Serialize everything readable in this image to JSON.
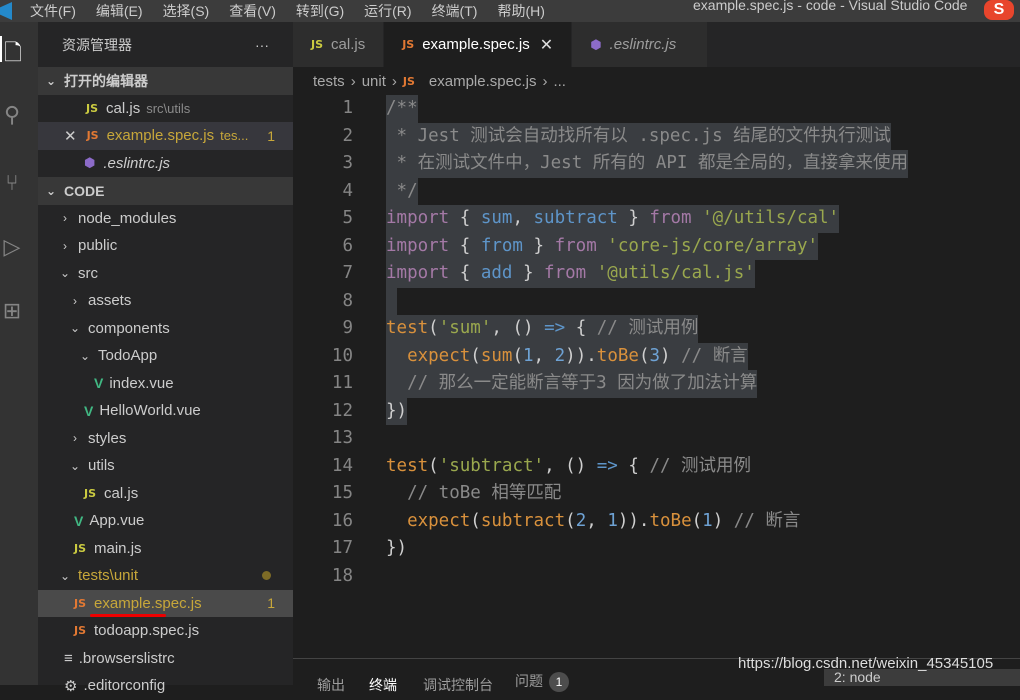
{
  "menu": {
    "items": [
      "文件(F)",
      "编辑(E)",
      "选择(S)",
      "查看(V)",
      "转到(G)",
      "运行(R)",
      "终端(T)",
      "帮助(H)"
    ],
    "window_title": "example.spec.js - code - Visual Studio Code"
  },
  "sidebar": {
    "title": "资源管理器",
    "more": "···",
    "open_editors": {
      "label": "打开的编辑器",
      "items": [
        {
          "name": "cal.js",
          "desc": "src\\utils"
        },
        {
          "name": "example.spec.js",
          "desc": "tes...",
          "badge": "1"
        },
        {
          "name": ".eslintrc.js"
        }
      ]
    },
    "workspace": {
      "label": "CODE",
      "items": [
        {
          "name": "node_modules"
        },
        {
          "name": "public"
        },
        {
          "name": "src"
        },
        {
          "name": "assets"
        },
        {
          "name": "components"
        },
        {
          "name": "TodoApp"
        },
        {
          "name": "index.vue"
        },
        {
          "name": "HelloWorld.vue"
        },
        {
          "name": "styles"
        },
        {
          "name": "utils"
        },
        {
          "name": "cal.js"
        },
        {
          "name": "App.vue"
        },
        {
          "name": "main.js"
        },
        {
          "name": "tests\\unit"
        },
        {
          "name": "example.spec.js",
          "badge": "1"
        },
        {
          "name": "todoapp.spec.js"
        },
        {
          "name": ".browserslistrc"
        },
        {
          "name": ".editorconfig"
        }
      ]
    }
  },
  "tabs": [
    {
      "label": "cal.js",
      "icon": "JS"
    },
    {
      "label": "example.spec.js",
      "icon": "JS",
      "close": "✕"
    },
    {
      "label": ".eslintrc.js",
      "icon": "eslint"
    }
  ],
  "breadcrumb": [
    "tests",
    "unit",
    "example.spec.js",
    "..."
  ],
  "code": [
    [
      [
        "/**",
        "cm"
      ]
    ],
    [
      [
        " * Jest 测试会自动找所有以 .spec.js 结尾的文件执行测试",
        "cm"
      ]
    ],
    [
      [
        " * 在测试文件中，Jest 所有的 API 都是全局的，直接拿来使用",
        "cm"
      ]
    ],
    [
      [
        " */",
        "cm"
      ]
    ],
    [
      [
        "import",
        "kw"
      ],
      [
        " { ",
        "pn"
      ],
      [
        "sum",
        "id"
      ],
      [
        ", ",
        "pn"
      ],
      [
        "subtract",
        "id"
      ],
      [
        " } ",
        "pn"
      ],
      [
        "from",
        "kw"
      ],
      [
        " ",
        "pn"
      ],
      [
        "'@/utils/cal'",
        "str"
      ]
    ],
    [
      [
        "import",
        "kw"
      ],
      [
        " { ",
        "pn"
      ],
      [
        "from",
        "id"
      ],
      [
        " } ",
        "pn"
      ],
      [
        "from",
        "kw"
      ],
      [
        " ",
        "pn"
      ],
      [
        "'core-js/core/array'",
        "str"
      ]
    ],
    [
      [
        "import",
        "kw"
      ],
      [
        " { ",
        "pn"
      ],
      [
        "add",
        "id"
      ],
      [
        " } ",
        "pn"
      ],
      [
        "from",
        "kw"
      ],
      [
        " ",
        "pn"
      ],
      [
        "'@utils/cal.js'",
        "str"
      ]
    ],
    [
      [
        "",
        "pn"
      ]
    ],
    [
      [
        "test",
        "fn"
      ],
      [
        "(",
        "pn"
      ],
      [
        "'sum'",
        "str"
      ],
      [
        ", () ",
        "pn"
      ],
      [
        "=>",
        "id"
      ],
      [
        " { ",
        "pn"
      ],
      [
        "// 测试用例",
        "cm"
      ]
    ],
    [
      [
        "  ",
        "pn"
      ],
      [
        "expect",
        "fn"
      ],
      [
        "(",
        "pn"
      ],
      [
        "sum",
        "fn"
      ],
      [
        "(",
        "pn"
      ],
      [
        "1",
        "num"
      ],
      [
        ", ",
        "pn"
      ],
      [
        "2",
        "num"
      ],
      [
        ")).",
        "pn"
      ],
      [
        "toBe",
        "fn"
      ],
      [
        "(",
        "pn"
      ],
      [
        "3",
        "num"
      ],
      [
        ") ",
        "pn"
      ],
      [
        "// 断言",
        "cm"
      ]
    ],
    [
      [
        "  // 那么一定能断言等于3 因为做了加法计算",
        "cm"
      ]
    ],
    [
      [
        "})",
        "pn"
      ]
    ],
    [
      [
        "",
        "pn"
      ]
    ],
    [
      [
        "test",
        "fn"
      ],
      [
        "(",
        "pn"
      ],
      [
        "'subtract'",
        "str"
      ],
      [
        ", () ",
        "pn"
      ],
      [
        "=>",
        "id"
      ],
      [
        " { ",
        "pn"
      ],
      [
        "// 测试用例",
        "cm"
      ]
    ],
    [
      [
        "  // toBe 相等匹配",
        "cm"
      ]
    ],
    [
      [
        "  ",
        "pn"
      ],
      [
        "expect",
        "fn"
      ],
      [
        "(",
        "pn"
      ],
      [
        "subtract",
        "fn"
      ],
      [
        "(",
        "pn"
      ],
      [
        "2",
        "num"
      ],
      [
        ", ",
        "pn"
      ],
      [
        "1",
        "num"
      ],
      [
        ")).",
        "pn"
      ],
      [
        "toBe",
        "fn"
      ],
      [
        "(",
        "pn"
      ],
      [
        "1",
        "num"
      ],
      [
        ") ",
        "pn"
      ],
      [
        "// 断言",
        "cm"
      ]
    ],
    [
      [
        "})",
        "pn"
      ]
    ],
    [
      [
        "",
        "pn"
      ]
    ]
  ],
  "panel": {
    "tabs": [
      "输出",
      "终端",
      "调试控制台",
      "问题"
    ],
    "problems_count": "1",
    "terminal": "2: node"
  },
  "watermark": "https://blog.csdn.net/weixin_45345105"
}
